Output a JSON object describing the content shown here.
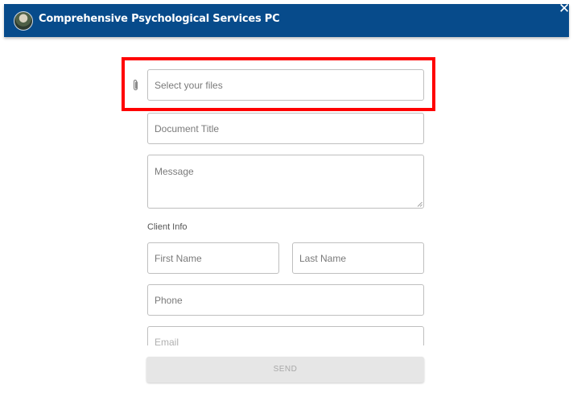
{
  "header": {
    "title": "Comprehensive Psychological Services PC",
    "logo_icon": "org-logo",
    "close_icon": "close-icon",
    "background": "#074b8b"
  },
  "form": {
    "files": {
      "placeholder": "Select your files",
      "icon": "paperclip-icon"
    },
    "document_title": {
      "placeholder": "Document Title"
    },
    "message": {
      "placeholder": "Message"
    },
    "client_info_label": "Client Info",
    "first_name": {
      "placeholder": "First Name"
    },
    "last_name": {
      "placeholder": "Last Name"
    },
    "phone": {
      "placeholder": "Phone"
    },
    "email": {
      "placeholder": "Email"
    },
    "send_label": "SEND"
  },
  "annotation": {
    "highlight_color": "#ff0000"
  }
}
